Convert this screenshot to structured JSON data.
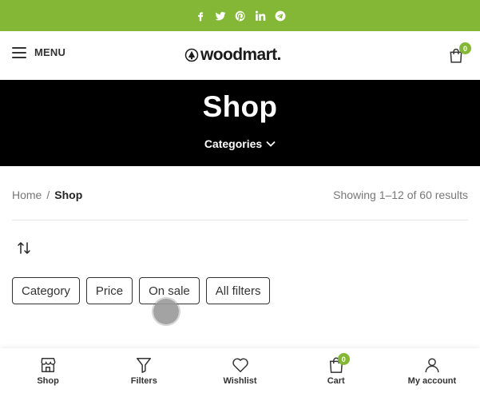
{
  "topbar": {
    "color": "#83b735",
    "social": [
      "facebook-icon",
      "twitter-icon",
      "pinterest-icon",
      "linkedin-icon",
      "telegram-icon"
    ]
  },
  "header": {
    "menu_label": "MENU",
    "logo_text": "woodmart.",
    "cart_count": "0"
  },
  "hero": {
    "title": "Shop",
    "categories_label": "Categories"
  },
  "breadcrumb": {
    "home": "Home",
    "separator": "/",
    "current": "Shop"
  },
  "results_text": "Showing 1–12 of 60 results",
  "filters": {
    "category": "Category",
    "price": "Price",
    "on_sale": "On sale",
    "all_filters": "All filters"
  },
  "bottom_nav": {
    "shop": "Shop",
    "filters": "Filters",
    "wishlist": "Wishlist",
    "cart": "Cart",
    "cart_count": "0",
    "account": "My account"
  },
  "accent_color": "#83b735"
}
